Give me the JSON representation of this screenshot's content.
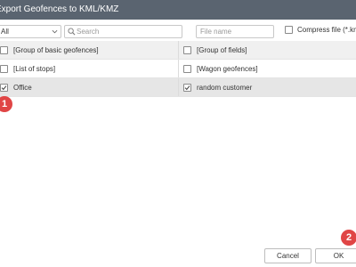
{
  "dialog": {
    "title": "Export Geofences to KML/KMZ"
  },
  "toolbar": {
    "filter_selected": "All",
    "search_placeholder": "Search",
    "filename_placeholder": "File name",
    "compress_label": "Compress file (*.kmz)",
    "compress_checked": false
  },
  "rows": [
    {
      "left": {
        "label": "[Group of basic geofences]",
        "checked": false
      },
      "right": {
        "label": "[Group of fields]",
        "checked": false
      }
    },
    {
      "left": {
        "label": "[List of stops]",
        "checked": false
      },
      "right": {
        "label": "[Wagon geofences]",
        "checked": false
      }
    },
    {
      "left": {
        "label": "Office",
        "checked": true
      },
      "right": {
        "label": "random customer",
        "checked": true
      }
    }
  ],
  "badges": {
    "first": "1",
    "second": "2"
  },
  "buttons": {
    "cancel_label": "Cancel",
    "ok_label": "OK"
  },
  "colors": {
    "titlebar": "#5a6470",
    "badge": "#e04545",
    "selected_row": "#e6e6e6",
    "shaded_row": "#f0f0f0"
  }
}
